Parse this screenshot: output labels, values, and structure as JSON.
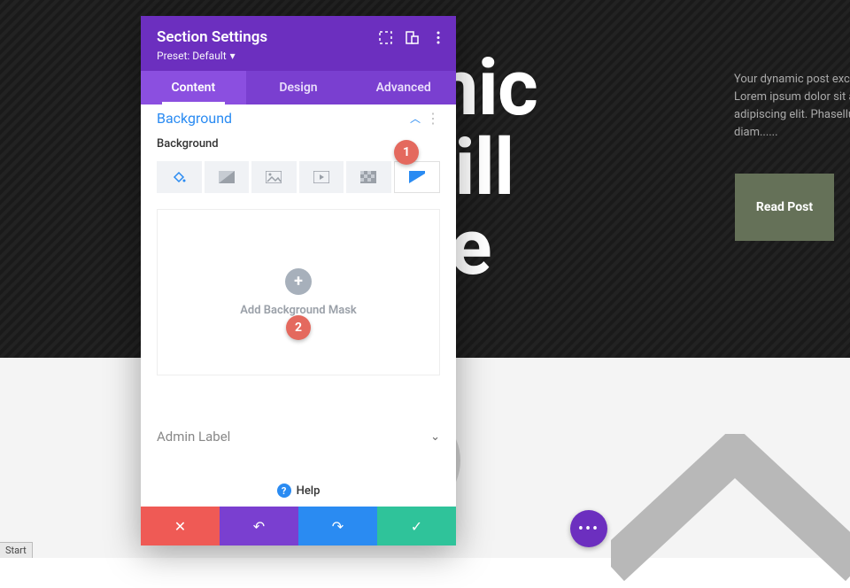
{
  "page": {
    "hero_title_lines": [
      "namic",
      "e Will",
      "Here"
    ],
    "excerpt": "Your dynamic post excer Lorem ipsum dolor sit ar adipiscing elit. Phasellus diam......",
    "read_post_label": "Read Post",
    "start_label": "Start"
  },
  "panel": {
    "title": "Section Settings",
    "preset_label": "Preset: Default",
    "tabs": {
      "content": "Content",
      "design": "Design",
      "advanced": "Advanced"
    },
    "section": {
      "title": "Background",
      "label": "Background",
      "mask": {
        "button": "Add Background Mask"
      }
    },
    "admin_label": "Admin Label",
    "help": "Help"
  },
  "annotations": {
    "one": "1",
    "two": "2"
  }
}
